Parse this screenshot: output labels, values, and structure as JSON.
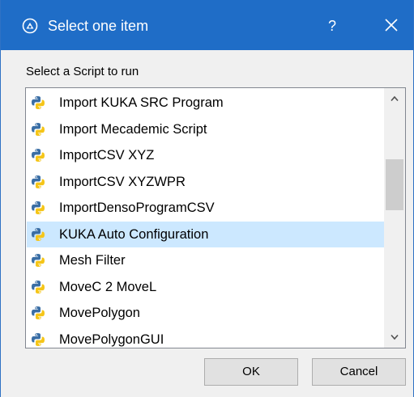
{
  "window": {
    "title": "Select one item",
    "help_label": "?"
  },
  "prompt": "Select a Script to run",
  "list": {
    "items": [
      {
        "label": "Import KUKA SRC Program",
        "icon": "python-icon",
        "selected": false
      },
      {
        "label": "Import Mecademic Script",
        "icon": "python-icon",
        "selected": false
      },
      {
        "label": "ImportCSV XYZ",
        "icon": "python-icon",
        "selected": false
      },
      {
        "label": "ImportCSV XYZWPR",
        "icon": "python-icon",
        "selected": false
      },
      {
        "label": "ImportDensoProgramCSV",
        "icon": "python-icon",
        "selected": false
      },
      {
        "label": "KUKA Auto Configuration",
        "icon": "python-icon",
        "selected": true
      },
      {
        "label": "Mesh Filter",
        "icon": "python-icon",
        "selected": false
      },
      {
        "label": "MoveC 2 MoveL",
        "icon": "python-icon",
        "selected": false
      },
      {
        "label": "MovePolygon",
        "icon": "python-icon",
        "selected": false
      },
      {
        "label": "MovePolygonGUI",
        "icon": "python-icon",
        "selected": false
      }
    ],
    "scroll_position_fraction": 0.3
  },
  "buttons": {
    "ok": "OK",
    "cancel": "Cancel"
  },
  "colors": {
    "titlebar": "#1f6dc7",
    "selection": "#cce8ff",
    "python_blue": "#3a6ea5",
    "python_yellow": "#f5c518"
  }
}
